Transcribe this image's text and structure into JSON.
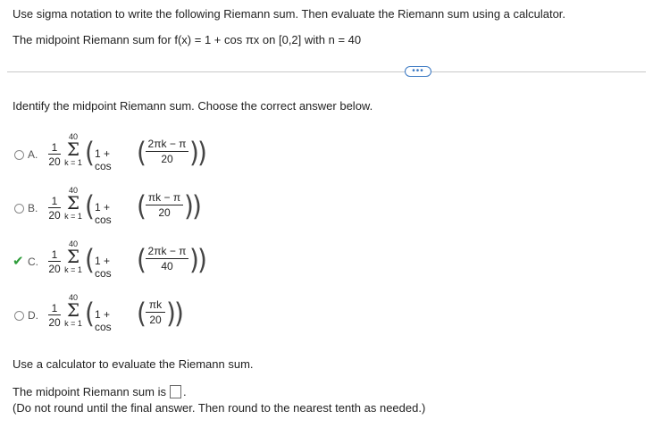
{
  "header": {
    "instruction": "Use sigma notation to write the following Riemann sum. Then evaluate the Riemann sum using a calculator.",
    "problem": "The midpoint Riemann sum for f(x) = 1 + cos πx on [0,2] with n = 40"
  },
  "more_button": {
    "label": "•••"
  },
  "question": {
    "prompt": "Identify the midpoint Riemann sum. Choose the correct answer below.",
    "options": [
      {
        "letter": "A.",
        "coef_num": "1",
        "coef_den": "20",
        "sum_upper": "40",
        "sum_lower": "k = 1",
        "term": "1 + cos",
        "arg_num": "2πk − π",
        "arg_den": "20",
        "selected": false
      },
      {
        "letter": "B.",
        "coef_num": "1",
        "coef_den": "20",
        "sum_upper": "40",
        "sum_lower": "k = 1",
        "term": "1 + cos",
        "arg_num": "πk − π",
        "arg_den": "20",
        "selected": false
      },
      {
        "letter": "C.",
        "coef_num": "1",
        "coef_den": "20",
        "sum_upper": "40",
        "sum_lower": "k = 1",
        "term": "1 + cos",
        "arg_num": "2πk − π",
        "arg_den": "40",
        "selected": true
      },
      {
        "letter": "D.",
        "coef_num": "1",
        "coef_den": "20",
        "sum_upper": "40",
        "sum_lower": "k = 1",
        "term": "1 + cos",
        "arg_num": "πk",
        "arg_den": "20",
        "selected": false
      }
    ]
  },
  "evaluate": {
    "prompt": "Use a calculator to evaluate the Riemann sum.",
    "answer_label": "The midpoint Riemann sum is",
    "answer_value": "",
    "answer_suffix": ".",
    "note": "(Do not round until the final answer. Then round to the nearest tenth as needed.)"
  },
  "colors": {
    "check": "#2e9d3a",
    "accent": "#3b79c3"
  }
}
